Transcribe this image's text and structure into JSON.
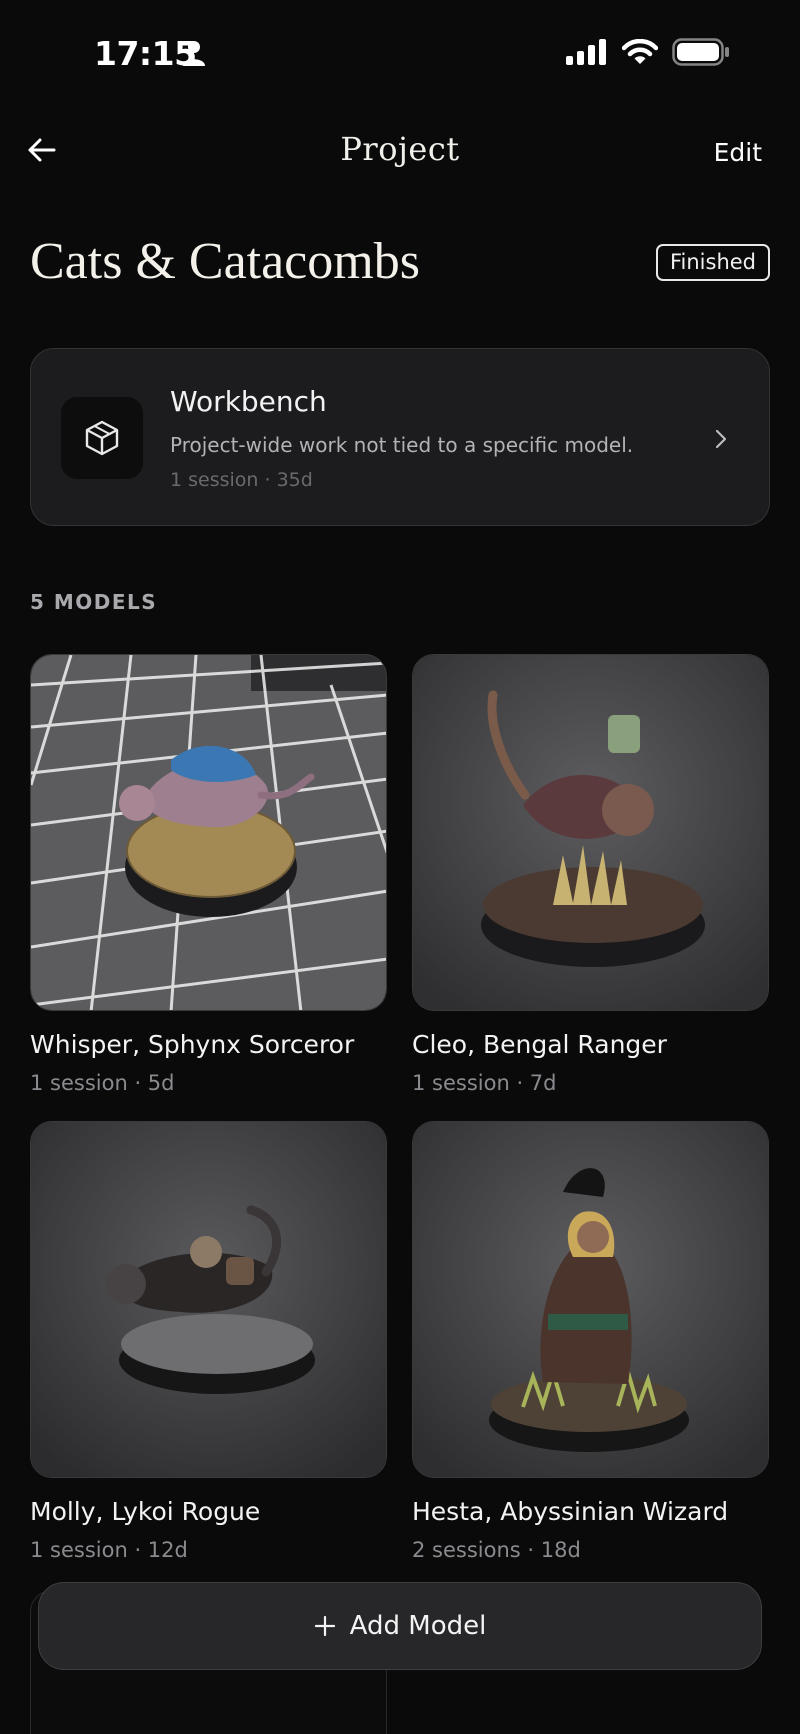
{
  "status_bar": {
    "time": "17:15"
  },
  "nav": {
    "title": "Project",
    "edit_label": "Edit"
  },
  "project": {
    "title": "Cats & Catacombs",
    "status": "Finished"
  },
  "workbench": {
    "title": "Workbench",
    "description": "Project-wide work not tied to a specific model.",
    "meta": "1 session · 35d",
    "icon": "cube-icon"
  },
  "models_label": "5 MODELS",
  "models": [
    {
      "name": "Whisper, Sphynx Sorceror",
      "meta": "1 session · 5d"
    },
    {
      "name": "Cleo, Bengal Ranger",
      "meta": "1 session · 7d"
    },
    {
      "name": "Molly, Lykoi Rogue",
      "meta": "1 session · 12d"
    },
    {
      "name": "Hesta, Abyssinian Wizard",
      "meta": "2 sessions · 18d"
    }
  ],
  "add_button": {
    "label": "Add Model"
  }
}
